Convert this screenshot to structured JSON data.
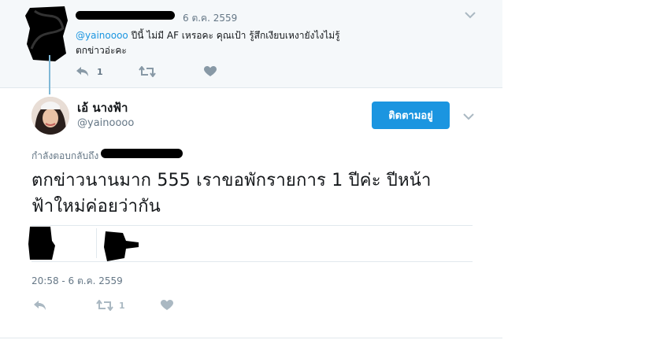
{
  "parent_tweet": {
    "date": "6 ต.ค. 2559",
    "mention": "@yainoooo",
    "text_line1": " ปีนี้ ไม่มี AF เหรอคะ คุณเป้า  รู้สึกเงียบเหงายังไงไม่รู้",
    "text_line2": "ตกข่าวอ่ะคะ",
    "reply_count": "1",
    "retweet_count": "",
    "like_count": ""
  },
  "main_tweet": {
    "display_name": "เอ้ นางฟ้า",
    "handle": "@yainoooo",
    "follow_label": "ติดตามอยู่",
    "replying_to_label": "กำลังตอบกลับถึง",
    "text": "ตกข่าวนานมาก 555 เราขอพักรายการ 1 ปีค่ะ ปีหน้าฟ้าใหม่ค่อยว่ากัน",
    "timestamp": "20:58 - 6 ต.ค. 2559",
    "reply_count": "",
    "retweet_count": "1",
    "like_count": ""
  },
  "colors": {
    "accent": "#1b95e0",
    "muted": "#657786",
    "icon": "#aab8c2",
    "parent_bg": "#f5f8fa"
  },
  "icons": [
    "chevron-down-icon",
    "reply-icon",
    "retweet-icon",
    "heart-icon"
  ]
}
